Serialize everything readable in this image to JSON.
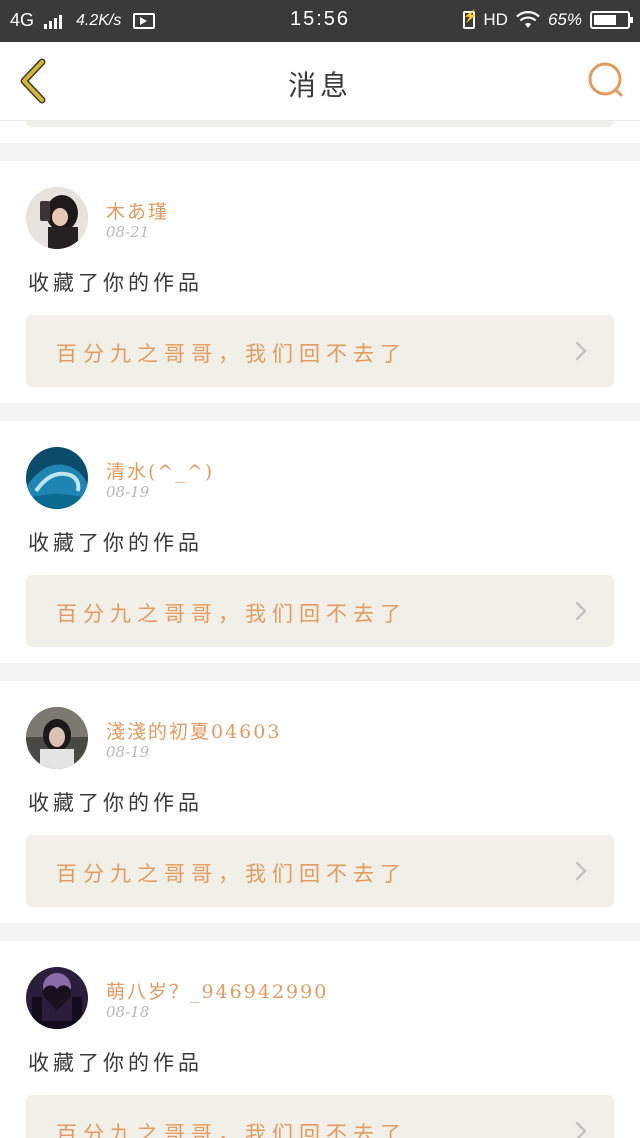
{
  "status_bar": {
    "network": "4G",
    "speed": "4.2K/s",
    "time": "15:56",
    "hd": "HD",
    "battery": "65%"
  },
  "header": {
    "back_icon": "chevron-left-icon",
    "title": "消息",
    "search_icon": "search-icon"
  },
  "notifications": [
    {
      "username": "木あ瑾",
      "date": "08-21",
      "action": "收藏了你的作品",
      "work_title": "百分九之哥哥，我们回不去了"
    },
    {
      "username": "清水(^_^)",
      "date": "08-19",
      "action": "收藏了你的作品",
      "work_title": "百分九之哥哥，我们回不去了"
    },
    {
      "username": "淺淺的初夏04603",
      "date": "08-19",
      "action": "收藏了你的作品",
      "work_title": "百分九之哥哥，我们回不去了"
    },
    {
      "username": "萌八岁？_946942990",
      "date": "08-18",
      "action": "收藏了你的作品",
      "work_title": "百分九之哥哥，我们回不去了"
    }
  ],
  "colors": {
    "accent": "#e59a5e",
    "back_icon": "#d8b830",
    "card_link_bg": "#f1f0e8",
    "status_bar_bg": "#3a3a3a"
  }
}
